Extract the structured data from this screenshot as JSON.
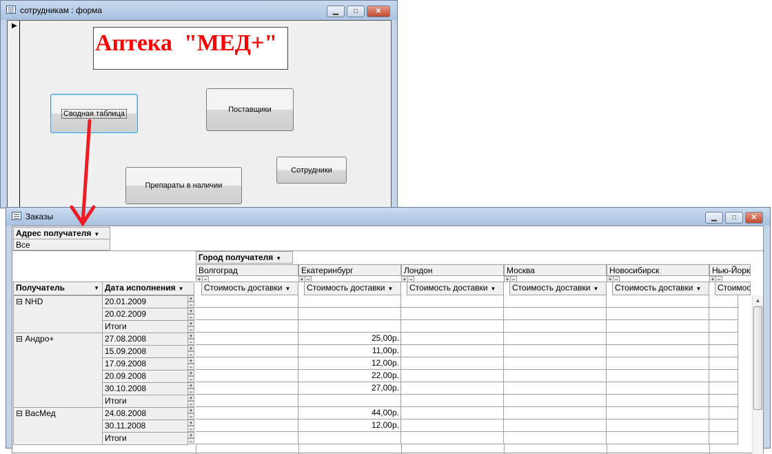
{
  "form_window": {
    "title": "сотрудникам : форма",
    "logo_text": "Аптека  \"МЕД+\"",
    "buttons": {
      "pivot": "Сводная таблица",
      "suppliers": "Поставщики",
      "drugs": "Препараты в наличии",
      "employees": "Сотрудники"
    }
  },
  "orders_window": {
    "title": "Заказы",
    "filter_field": "Адрес получателя",
    "filter_value": "Все",
    "column_field": "Город получателя",
    "cities": [
      "Волгоград",
      "Екатеринбург",
      "Лондон",
      "Москва",
      "Новосибирск",
      "Нью-Йорк"
    ],
    "data_field": "Стоимость доставки",
    "data_field_truncated": "Стоимость ,",
    "row_fields": [
      "Получатель",
      "Дата исполнения"
    ],
    "groups": [
      {
        "name": "NHD",
        "rows": [
          {
            "date": "20.01.2009",
            "value": ""
          },
          {
            "date": "20.02.2009",
            "value": ""
          },
          {
            "date": "Итоги",
            "value": ""
          }
        ]
      },
      {
        "name": "Андро+",
        "rows": [
          {
            "date": "27.08.2008",
            "value": "25,00р."
          },
          {
            "date": "15.09.2008",
            "value": "11,00р."
          },
          {
            "date": "17.09.2008",
            "value": "12,00р."
          },
          {
            "date": "20.09.2008",
            "value": "22,00р."
          },
          {
            "date": "30.10.2008",
            "value": "27,00р."
          },
          {
            "date": "Итоги",
            "value": ""
          }
        ]
      },
      {
        "name": "ВасМед",
        "rows": [
          {
            "date": "24.08.2008",
            "value": "44,00р."
          },
          {
            "date": "30.11.2008",
            "value": "12,00р."
          },
          {
            "date": "Итоги",
            "value": ""
          }
        ]
      }
    ]
  },
  "colors": {
    "arrow": "#ee1c24",
    "logo": "#ff0000"
  }
}
